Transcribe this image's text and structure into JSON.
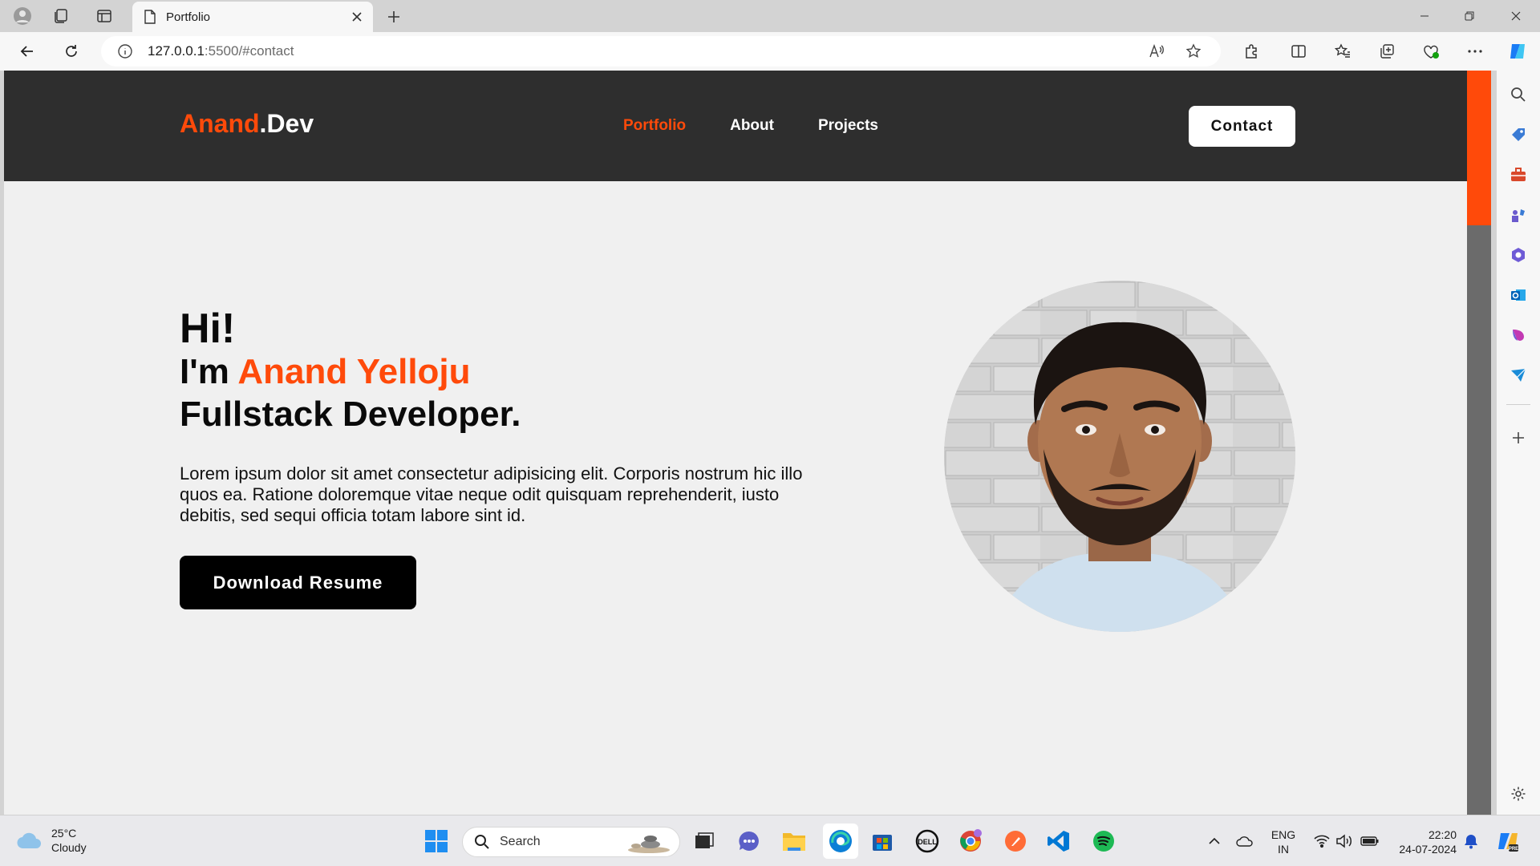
{
  "browser": {
    "tab_title": "Portfolio",
    "url_host": "127.0.0.1",
    "url_path": ":5500/#contact"
  },
  "nav": {
    "logo_accent": "Anand",
    "logo_rest": ".Dev",
    "links": [
      "Portfolio",
      "About",
      "Projects"
    ],
    "active_link": "Portfolio",
    "contact_label": "Contact"
  },
  "hero": {
    "greeting": "Hi!",
    "intro_prefix": "I'm ",
    "name": "Anand Yelloju",
    "role": "Fullstack Developer.",
    "description": "Lorem ipsum dolor sit amet consectetur adipisicing elit. Corporis nostrum hic illo quos ea. Ratione doloremque vitae neque odit quisquam reprehenderit, iusto debitis, sed sequi officia totam labore sint id.",
    "button_label": "Download Resume"
  },
  "taskbar": {
    "weather_temp": "25°C",
    "weather_desc": "Cloudy",
    "search_label": "Search",
    "lang_line1": "ENG",
    "lang_line2": "IN",
    "time": "22:20",
    "date": "24-07-2024"
  },
  "colors": {
    "accent": "#ff4a0a",
    "nav_bg": "#2e2e2e",
    "page_bg": "#f0f0f0"
  }
}
